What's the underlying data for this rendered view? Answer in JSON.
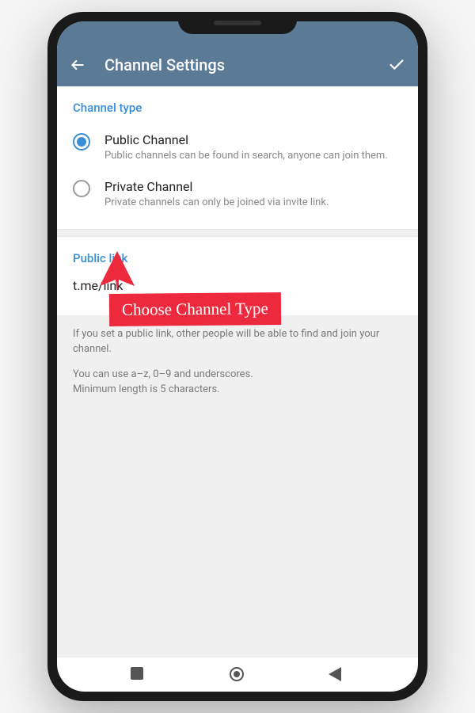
{
  "header": {
    "title": "Channel Settings"
  },
  "channelType": {
    "sectionTitle": "Channel type",
    "options": [
      {
        "title": "Public Channel",
        "desc": "Public channels can be found in search, anyone can join them.",
        "selected": true
      },
      {
        "title": "Private Channel",
        "desc": "Private channels can only be joined via invite link.",
        "selected": false
      }
    ]
  },
  "publicLink": {
    "sectionTitle": "Public link",
    "value": "t.me/link"
  },
  "help": {
    "p1": "If you set a public link, other people will be able to find and join your channel.",
    "p2": "You can use a–z, 0–9 and underscores.\nMinimum length is 5 characters."
  },
  "annotation": {
    "label": "Choose Channel Type"
  }
}
